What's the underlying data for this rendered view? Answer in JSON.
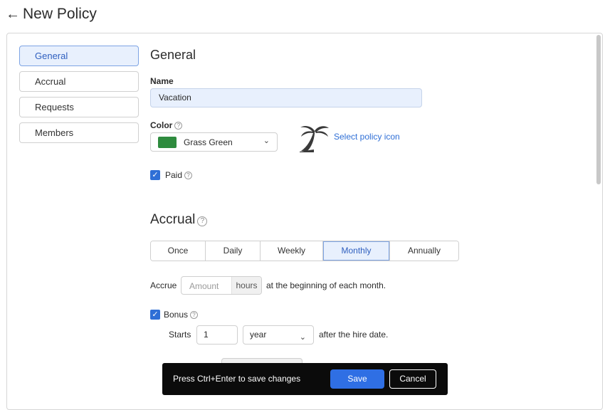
{
  "header": {
    "title": "New Policy",
    "back_icon": "arrow-left-icon"
  },
  "nav": {
    "items": [
      {
        "label": "General",
        "active": true
      },
      {
        "label": "Accrual",
        "active": false
      },
      {
        "label": "Requests",
        "active": false
      },
      {
        "label": "Members",
        "active": false
      }
    ]
  },
  "general": {
    "heading": "General",
    "name_label": "Name",
    "name_value": "Vacation",
    "color_label": "Color",
    "color_value": "Grass Green",
    "color_swatch": "#2e8b3e",
    "policy_icon": "palm-tree-icon",
    "select_icon_link": "Select policy icon",
    "paid_label": "Paid",
    "paid_checked": true
  },
  "accrual": {
    "heading": "Accrual",
    "frequencies": [
      "Once",
      "Daily",
      "Weekly",
      "Monthly",
      "Annually"
    ],
    "selected_frequency": "Monthly",
    "accrue_label": "Accrue",
    "amount_placeholder": "Amount",
    "amount_unit": "hours",
    "accrue_suffix": "at the beginning of each month.",
    "bonus_label": "Bonus",
    "bonus_checked": true,
    "starts_label": "Starts",
    "starts_value": "1",
    "starts_unit": "year",
    "starts_suffix": "after the hire date."
  },
  "toast": {
    "message": "Press Ctrl+Enter to save changes",
    "save_label": "Save",
    "cancel_label": "Cancel"
  },
  "colors": {
    "accent": "#2f6fe4",
    "active_bg": "#e8f0fd"
  }
}
